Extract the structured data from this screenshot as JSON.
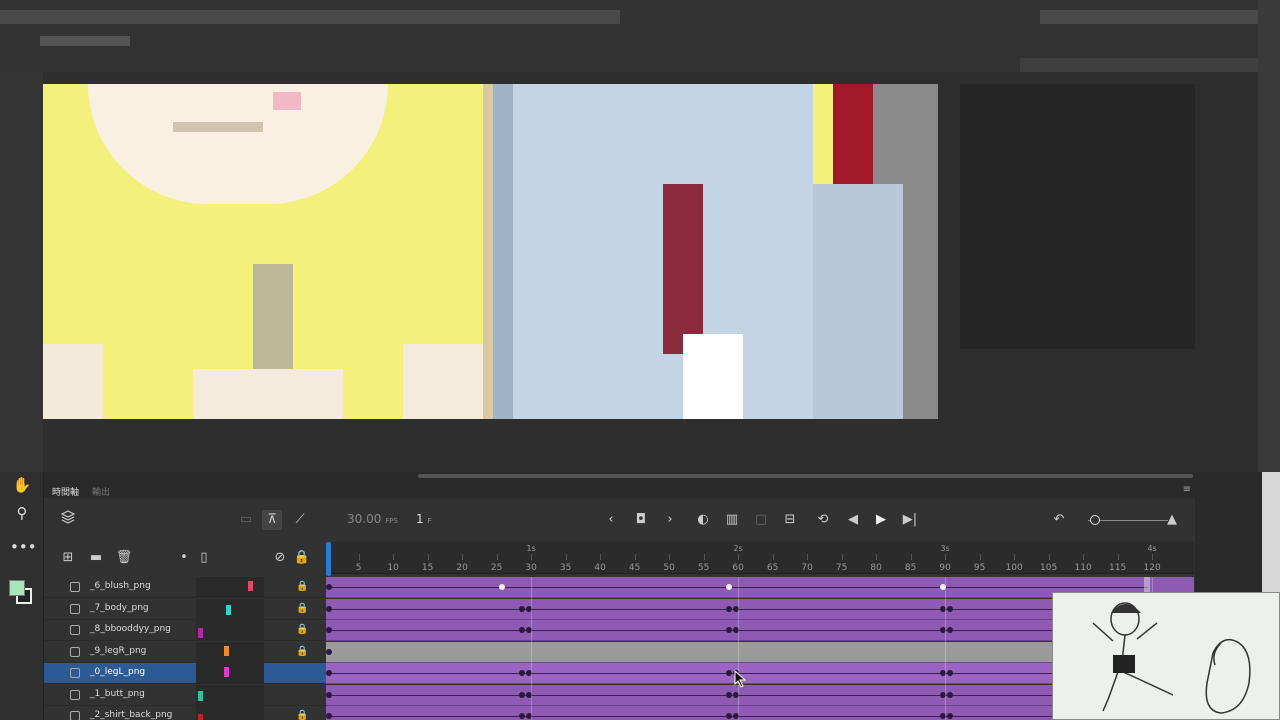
{
  "timeline": {
    "tab_timeline": "時間軸",
    "tab_output": "輸出",
    "menu": "≡",
    "fps_value": "30.00",
    "fps_unit": "FPS",
    "current_frame": "1",
    "frame_unit": "F"
  },
  "ruler": {
    "ticks": [
      "5",
      "10",
      "15",
      "20",
      "25",
      "30",
      "35",
      "40",
      "45",
      "50",
      "55",
      "60",
      "65",
      "70",
      "75",
      "80",
      "85",
      "90",
      "95",
      "100",
      "105",
      "110",
      "115",
      "120"
    ],
    "seconds": [
      "1s",
      "2s",
      "3s",
      "4s"
    ]
  },
  "layers": [
    {
      "name": "_6_blush_png",
      "locked": true
    },
    {
      "name": "_7_body_png",
      "locked": true
    },
    {
      "name": "_8_bbooddyy_png",
      "locked": true
    },
    {
      "name": "_9_legR_png",
      "locked": true
    },
    {
      "name": "_0_legL_png",
      "locked": false,
      "selected": true
    },
    {
      "name": "_1_butt_png",
      "locked": false
    },
    {
      "name": "_2_shirt_back_png",
      "locked": true
    }
  ],
  "colors": {
    "frame_purple": "#8e5ab4",
    "selected_layer": "#2c5a94",
    "playhead": "#2a7bd6",
    "fill_swatch": "#a8e6b8"
  },
  "icons": {
    "hand": "hand-icon",
    "zoom": "zoom-icon",
    "more": "more-icon",
    "layers": "layers-icon",
    "play": "play-icon"
  }
}
